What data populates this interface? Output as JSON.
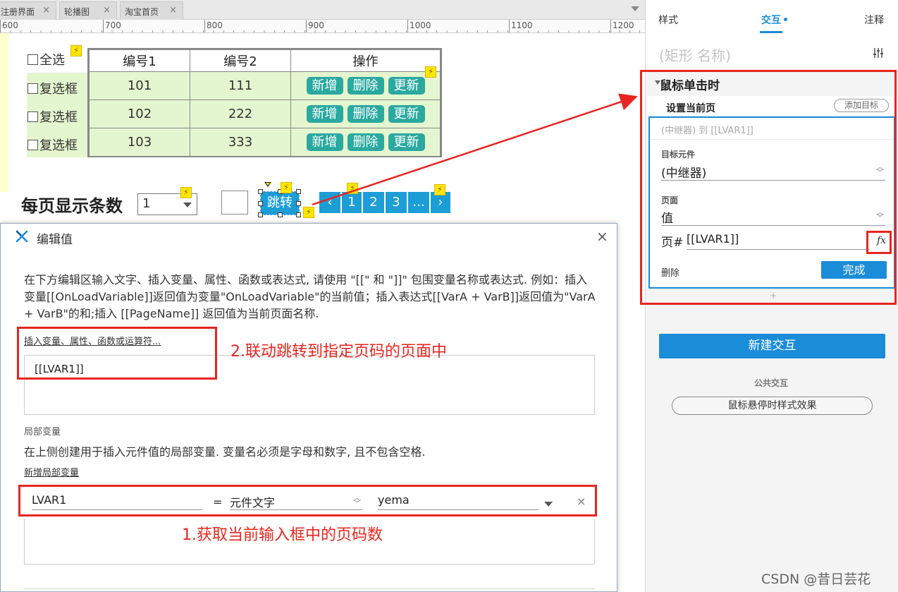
{
  "tabs": [
    {
      "label": "注册界面"
    },
    {
      "label": "轮播图"
    },
    {
      "label": "淘宝首页"
    }
  ],
  "ruler": {
    "ticks": [
      "600",
      "700",
      "800",
      "900",
      "1000",
      "1100",
      "1200"
    ]
  },
  "canvas": {
    "select_all_label": "全选",
    "table": {
      "headers": [
        "编号1",
        "编号2",
        "操作"
      ],
      "rows": [
        {
          "checkbox": "复选框",
          "id1": "101",
          "id2": "111"
        },
        {
          "checkbox": "复选框",
          "id1": "102",
          "id2": "222"
        },
        {
          "checkbox": "复选框",
          "id1": "103",
          "id2": "333"
        }
      ],
      "op_buttons": [
        "新增",
        "删除",
        "更新"
      ]
    },
    "per_page_label": "每页显示条数",
    "per_page_value": "1",
    "jump_label": "跳转",
    "pagination": [
      "‹",
      "1",
      "2",
      "3",
      "...",
      "›"
    ],
    "bolt_icon": "lightning-icon",
    "colors": {
      "row_fill": "#e4f6cf",
      "action_teal": "#2aa9a0",
      "pager_blue": "#1c9dd6",
      "bolt_yellow": "#ffe600"
    }
  },
  "right_panel": {
    "tabs": {
      "style": "样式",
      "interaction": "交互",
      "notes": "注释"
    },
    "shape_name_placeholder": "(矩形 名称)",
    "event_title": "鼠标单击时",
    "action": {
      "name": "设置当前页",
      "add_target": "添加目标",
      "summary": "(中继器) 到 [[LVAR1]]",
      "target_label": "目标元件",
      "target_value": "(中继器)",
      "page_label": "页面",
      "page_value": "值",
      "page_hash_label": "页#",
      "page_hash_value": "[[LVAR1]]",
      "fx": "fx",
      "delete": "删除",
      "done": "完成"
    },
    "plus": "+",
    "new_interaction": "新建交互",
    "common_label": "公共交互",
    "hover_style": "鼠标悬停时样式效果",
    "colors": {
      "accent": "#1a8cd8"
    }
  },
  "dialog": {
    "title": "编辑值",
    "close": "×",
    "help_text": "在下方编辑区输入文字、插入变量、属性、函数或表达式, 请使用 \"[[\" 和 \"]]\" 包围变量名称或表达式. 例如：插入变量[[OnLoadVariable]]返回值为变量\"OnLoadVariable\"的当前值；插入表达式[[VarA + VarB]]返回值为\"VarA + VarB\"的和;插入 [[PageName]] 返回值为当前页面名称.",
    "insert_link": "插入变量、属性、函数或运算符...",
    "expression": "[[LVAR1]]",
    "local_vars_title": "局部变量",
    "local_vars_desc": "在上侧创建用于插入元件值的局部变量. 变量名必须是字母和数字, 且不包含空格.",
    "add_local_var": "新增局部变量",
    "var": {
      "name": "LVAR1",
      "eq": "=",
      "type": "元件文字",
      "target": "yema",
      "remove": "×"
    }
  },
  "annotations": {
    "step1": "1.获取当前输入框中的页码数",
    "step2": "2.联动跳转到指定页码的页面中",
    "color": "#e8251f"
  },
  "watermark": "CSDN @昔日芸花"
}
